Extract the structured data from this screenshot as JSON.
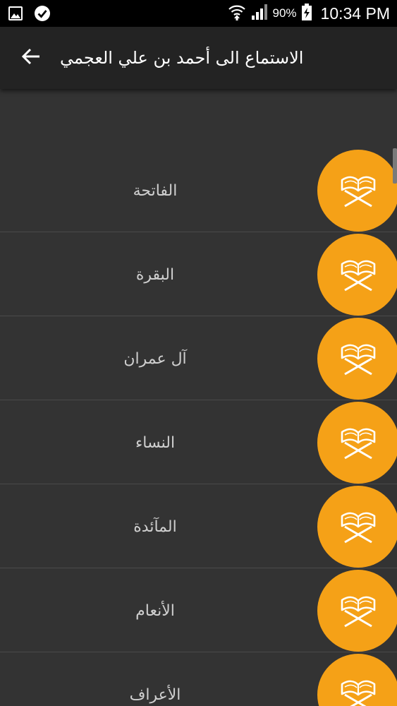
{
  "status_bar": {
    "battery": "90%",
    "time": "10:34 PM",
    "icons": [
      "gallery-icon",
      "check-circle-icon",
      "wifi-icon",
      "signal-icon",
      "battery-charging-icon"
    ]
  },
  "app_bar": {
    "title": "الاستماع الى أحمد بن علي العجمي",
    "back_icon": "arrow-left-icon"
  },
  "colors": {
    "accent": "#f5a117",
    "background": "#333333",
    "app_bar": "#232323",
    "status_bar": "#000000",
    "label": "#cfcfcf"
  },
  "surahs": [
    {
      "name": "الفاتحة",
      "icon": "quran-stand-icon"
    },
    {
      "name": "البقرة",
      "icon": "quran-stand-icon"
    },
    {
      "name": "آل عمران",
      "icon": "quran-stand-icon"
    },
    {
      "name": "النساء",
      "icon": "quran-stand-icon"
    },
    {
      "name": "المآئدة",
      "icon": "quran-stand-icon"
    },
    {
      "name": "الأنعام",
      "icon": "quran-stand-icon"
    },
    {
      "name": "الأعراف",
      "icon": "quran-stand-icon"
    }
  ]
}
